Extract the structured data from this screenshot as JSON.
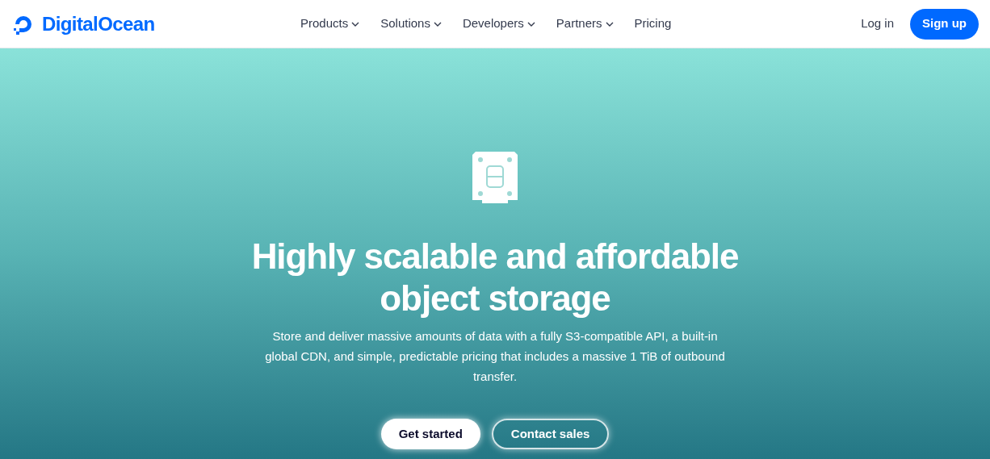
{
  "header": {
    "logo": "DigitalOcean",
    "nav": [
      {
        "label": "Products",
        "has_menu": true
      },
      {
        "label": "Solutions",
        "has_menu": true
      },
      {
        "label": "Developers",
        "has_menu": true
      },
      {
        "label": "Partners",
        "has_menu": true
      },
      {
        "label": "Pricing",
        "has_menu": false
      }
    ],
    "login": "Log in",
    "signup": "Sign up"
  },
  "hero": {
    "title": "Highly scalable and affordable object storage",
    "description": "Store and deliver massive amounts of data with a fully S3-compatible API, a built-in global CDN, and simple, predictable pricing that includes a massive 1 TiB of outbound transfer.",
    "buttons": [
      {
        "label": "Get started",
        "kind": "primary"
      },
      {
        "label": "Contact sales",
        "kind": "outline"
      }
    ]
  }
}
